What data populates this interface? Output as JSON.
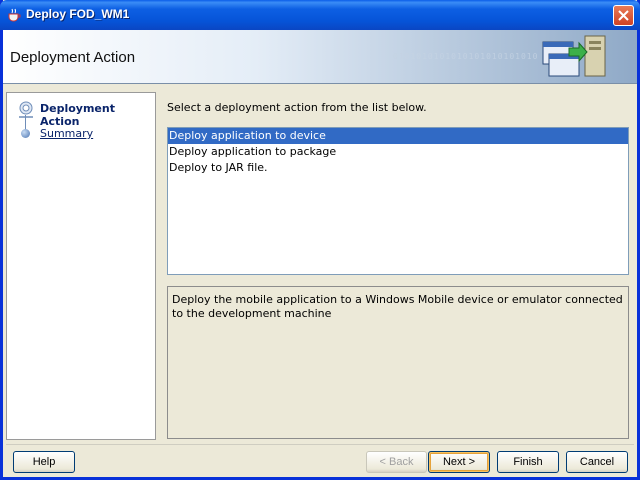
{
  "window": {
    "title": "Deploy FOD_WM1",
    "icon": "java-cup-icon"
  },
  "header": {
    "title": "Deployment Action",
    "decoration_text": "0101010101010101010101010"
  },
  "nav": {
    "items": [
      {
        "label": "Deployment Action",
        "state": "current"
      },
      {
        "label": "Summary",
        "state": "link"
      }
    ]
  },
  "main": {
    "instruction": "Select a deployment action from the list below.",
    "actions": [
      {
        "label": "Deploy application to device",
        "selected": true
      },
      {
        "label": "Deploy application to package",
        "selected": false
      },
      {
        "label": "Deploy to JAR file.",
        "selected": false
      }
    ],
    "description": "Deploy the mobile application to a Windows Mobile device or emulator connected to the development machine"
  },
  "buttons": {
    "help": "Help",
    "back": "< Back",
    "next": "Next >",
    "finish": "Finish",
    "cancel": "Cancel"
  },
  "colors": {
    "titlebar": "#0654d8",
    "selection": "#316ac5",
    "dialog_bg": "#ece9d8",
    "close": "#cf4224"
  }
}
